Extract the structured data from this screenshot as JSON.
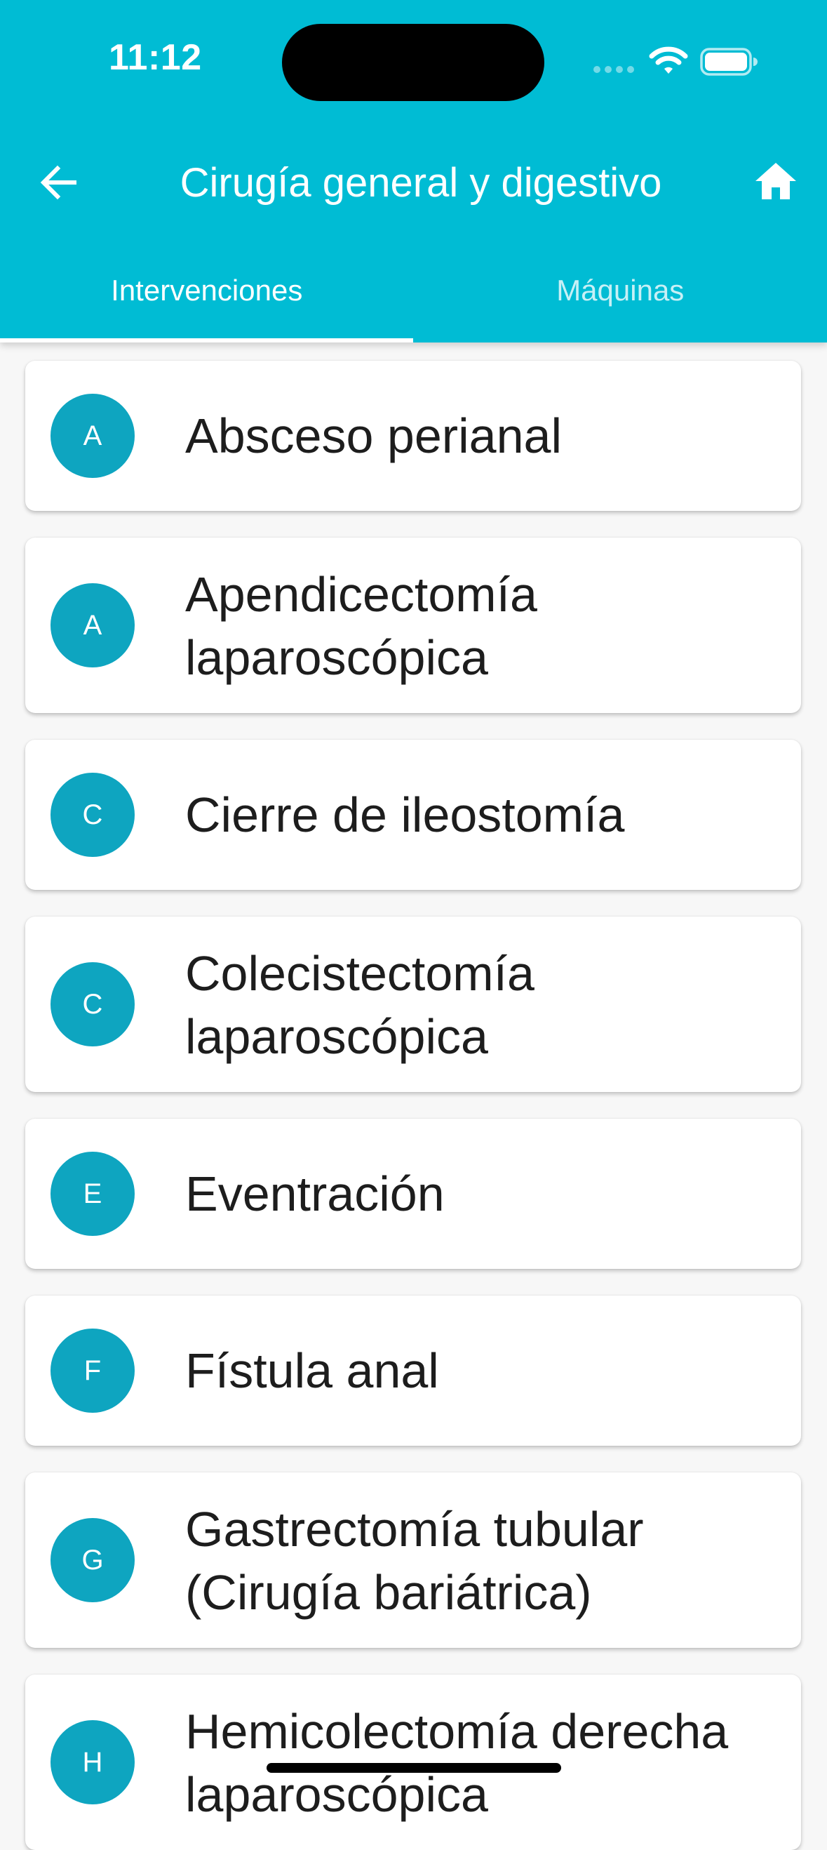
{
  "status_bar": {
    "time": "11:12"
  },
  "header": {
    "title": "Cirugía general y digestivo",
    "back_icon": "arrow-left-icon",
    "home_icon": "home-icon",
    "background_color": "#00bcd4"
  },
  "tabs": [
    {
      "label": "Intervenciones",
      "active": true
    },
    {
      "label": "Máquinas",
      "active": false
    }
  ],
  "items": [
    {
      "initial": "A",
      "label": "Absceso perianal"
    },
    {
      "initial": "A",
      "label": "Apendicectomía laparoscópica"
    },
    {
      "initial": "C",
      "label": "Cierre de ileostomía"
    },
    {
      "initial": "C",
      "label": "Colecistectomía laparoscópica"
    },
    {
      "initial": "E",
      "label": "Eventración"
    },
    {
      "initial": "F",
      "label": "Fístula anal"
    },
    {
      "initial": "G",
      "label": "Gastrectomía tubular (Cirugía bariátrica)"
    },
    {
      "initial": "H",
      "label": "Hemicolectomía derecha laparoscópica"
    }
  ],
  "colors": {
    "accent": "#00bcd4",
    "avatar": "#0ea5c0"
  }
}
